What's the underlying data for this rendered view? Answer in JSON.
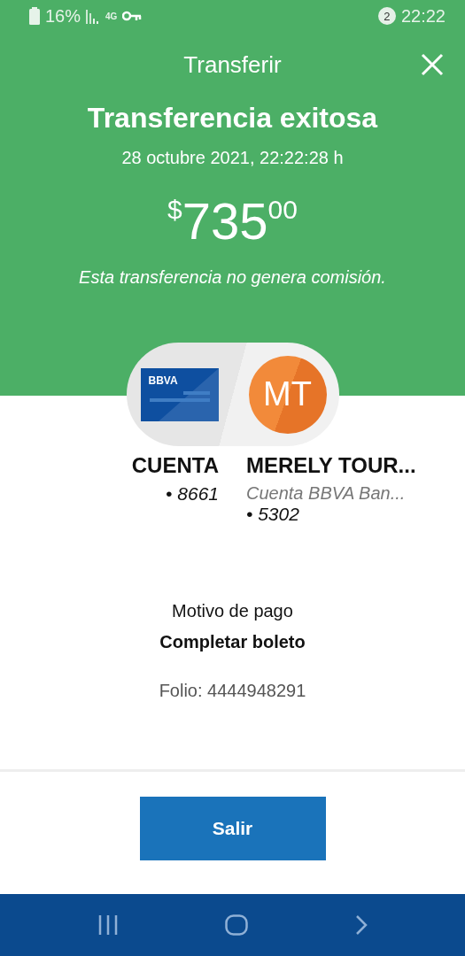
{
  "status_bar": {
    "battery": "16%",
    "network": "4G",
    "notifications": "2",
    "time": "22:22"
  },
  "header": {
    "title": "Transferir",
    "heading": "Transferencia exitosa",
    "date": "28 octubre 2021, 22:22:28 h",
    "amount": {
      "currency": "$",
      "whole": "735",
      "cents": "00"
    },
    "note": "Esta transferencia no genera comisión."
  },
  "origin": {
    "card_brand": "BBVA",
    "name": "CUENTA",
    "number": "• 8661"
  },
  "destination": {
    "initials": "MT",
    "name": "MERELY TOUR...",
    "bank": "Cuenta BBVA Ban...",
    "number": "• 5302"
  },
  "details": {
    "reason_label": "Motivo de pago",
    "reason": "Completar boleto",
    "folio": "Folio: 4444948291"
  },
  "button": "Salir"
}
